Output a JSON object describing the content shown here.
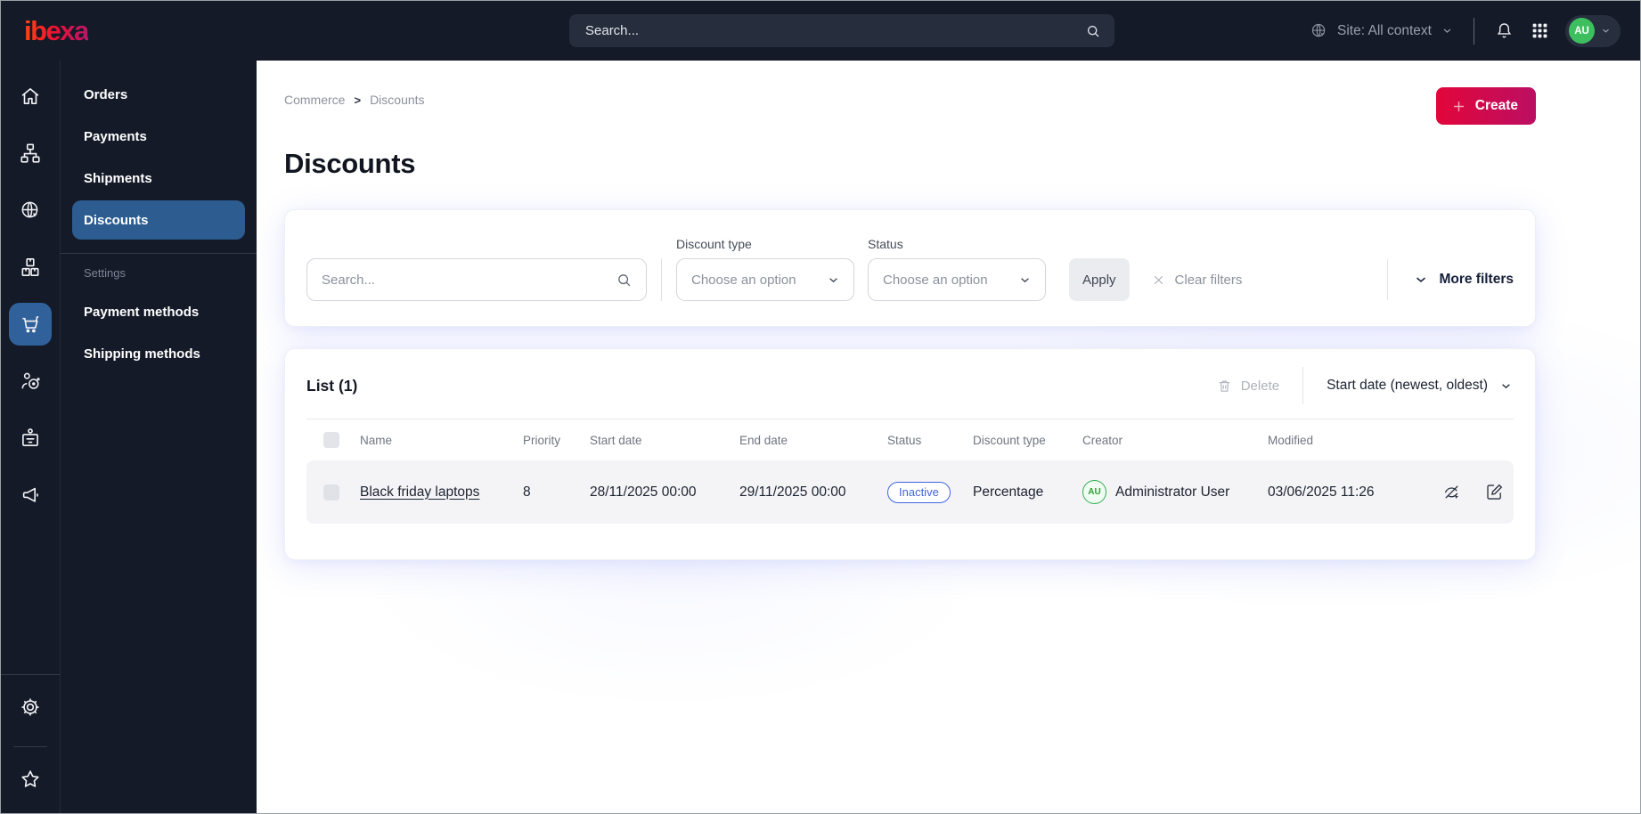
{
  "topbar": {
    "logo_text": "ibexa",
    "search_placeholder": "Search...",
    "site_context_label": "Site: All context",
    "user_initials": "AU"
  },
  "sidebar_rail": {
    "icons": [
      "home-icon",
      "content-tree-icon",
      "site-globe-icon",
      "product-boxes-icon",
      "commerce-cart-icon",
      "personalization-target-icon",
      "corporate-badge-icon",
      "marketing-megaphone-icon",
      "settings-gear-icon",
      "bookmarks-star-icon"
    ],
    "active_icon": "commerce-cart-icon"
  },
  "commerce_menu": {
    "items": [
      {
        "label": "Orders"
      },
      {
        "label": "Payments"
      },
      {
        "label": "Shipments"
      },
      {
        "label": "Discounts",
        "active": true
      }
    ],
    "section_label": "Settings",
    "settings_items": [
      {
        "label": "Payment methods"
      },
      {
        "label": "Shipping methods"
      }
    ]
  },
  "breadcrumb": {
    "items": [
      "Commerce",
      "Discounts"
    ],
    "separator": ">"
  },
  "page": {
    "title": "Discounts",
    "create_label": "Create"
  },
  "filters": {
    "search_placeholder": "Search...",
    "discount_type": {
      "label": "Discount type",
      "value": "Choose an option"
    },
    "status": {
      "label": "Status",
      "value": "Choose an option"
    },
    "apply_label": "Apply",
    "clear_filters_label": "Clear filters",
    "more_filters_label": "More filters"
  },
  "list": {
    "title": "List (1)",
    "delete_label": "Delete",
    "sort_label": "Start date (newest, oldest)",
    "columns": [
      "Name",
      "Priority",
      "Start date",
      "End date",
      "Status",
      "Discount type",
      "Creator",
      "Modified"
    ],
    "rows": [
      {
        "name": "Black friday laptops",
        "priority": "8",
        "start_date": "28/11/2025 00:00",
        "end_date": "29/11/2025 00:00",
        "status": "Inactive",
        "discount_type": "Percentage",
        "creator_initials": "AU",
        "creator_name": "Administrator User",
        "modified": "03/06/2025 11:26"
      }
    ]
  },
  "colors": {
    "topbar_bg": "#141a28",
    "active_blue": "#2c5c90",
    "create_gradient_start": "#e2063a",
    "create_gradient_end": "#bb0f63",
    "status_badge_blue": "#4164e0",
    "avatar_green": "#3ebf5f"
  }
}
